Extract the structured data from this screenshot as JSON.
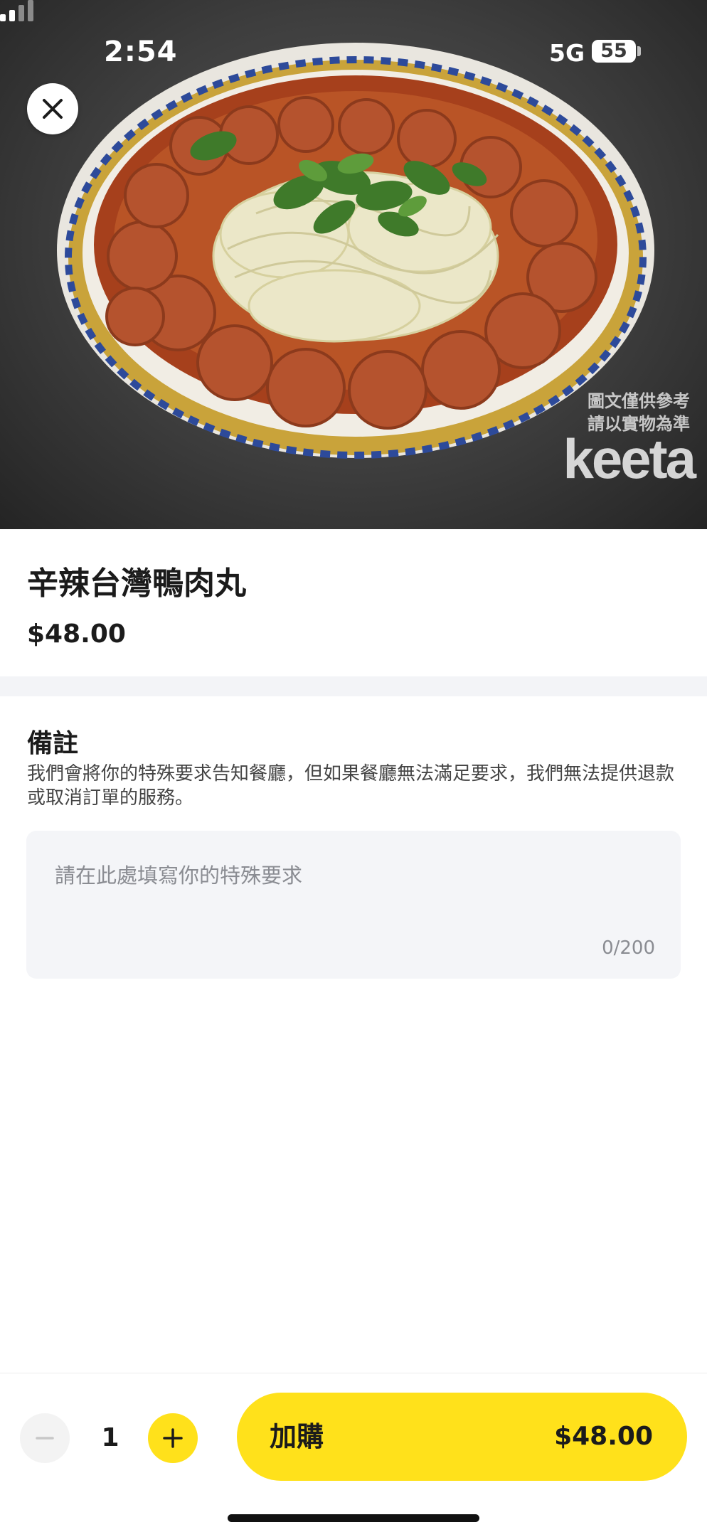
{
  "status_bar": {
    "time": "2:54",
    "network": "5G",
    "battery": "55"
  },
  "hero": {
    "image_subject": "bowl of duck meatball soup with cabbage, vermicelli and coriander",
    "watermark_line1": "圖文僅供參考",
    "watermark_line2": "請以實物為準",
    "logo": "keeta",
    "close_icon": "close-icon"
  },
  "item": {
    "title": "辛辣台灣鴨肉丸",
    "price": "$48.00"
  },
  "notes": {
    "title": "備註",
    "description": "我們會將你的特殊要求告知餐廳，但如果餐廳無法滿足要求，我們無法提供退款或取消訂單的服務。",
    "placeholder": "請在此處填寫你的特殊要求",
    "counter": "0/200"
  },
  "cart": {
    "quantity": "1",
    "minus_icon": "minus-icon",
    "plus_icon": "plus-icon",
    "add_label": "加購",
    "add_price": "$48.00"
  },
  "colors": {
    "accent": "#ffe11b",
    "text": "#1b1b1b",
    "muted": "#8a8c92",
    "input_bg": "#f4f5f8"
  }
}
